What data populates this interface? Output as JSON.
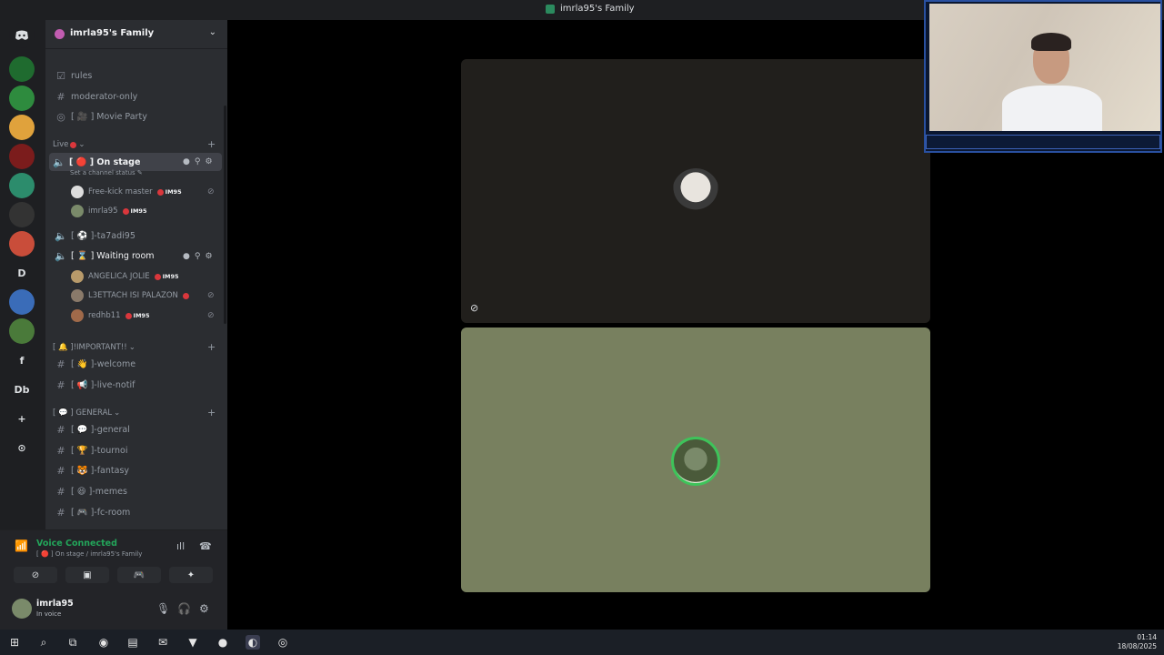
{
  "window": {
    "title": "imrla95's Family"
  },
  "rail": {
    "items": [
      {
        "icon": "discord-home-icon"
      },
      {
        "label": "",
        "color": "#1f6b2f"
      },
      {
        "label": "",
        "color": "#2e8b3e"
      },
      {
        "label": "",
        "color": "#e0a23c"
      },
      {
        "label": "",
        "color": "#7b1c1c"
      },
      {
        "label": "",
        "color": "#2c8c6c"
      },
      {
        "label": "",
        "color": "#222"
      },
      {
        "label": "",
        "color": "#c94d3a"
      },
      {
        "label": "D",
        "color": "#1e1f22"
      },
      {
        "label": "",
        "color": "#3a6cb8"
      },
      {
        "label": "",
        "color": "#4a7a3a"
      },
      {
        "label": "f",
        "color": "#1e1f22"
      },
      {
        "label": "Db",
        "color": "#1e1f22"
      },
      {
        "label": "+",
        "color": "#1e1f22"
      },
      {
        "label": "⊙",
        "color": "#1e1f22"
      }
    ]
  },
  "server": {
    "name": "imrla95's Family"
  },
  "channels": {
    "top": [
      {
        "icon": "☑",
        "label": "rules"
      },
      {
        "icon": "#",
        "label": "moderator-only"
      },
      {
        "icon": "◎",
        "label": "[ 🎥 ] Movie Party"
      }
    ],
    "live_category": "Live",
    "on_stage": {
      "label": "[ 🔴 ] On stage",
      "status": "Set a channel status"
    },
    "on_stage_users": [
      {
        "name": "Free-kick master",
        "badge": "IM95"
      },
      {
        "name": "imrla95",
        "badge": "IM95"
      }
    ],
    "tazadi": {
      "label": "[ ⚽ ]-ta7adi95"
    },
    "waiting": {
      "label": "[ ⌛ ] Waiting room"
    },
    "waiting_users": [
      {
        "name": "ANGELICA JOLIE",
        "badge": "IM95"
      },
      {
        "name": "L3ETTACH ISI PALAZON",
        "badge": ""
      },
      {
        "name": "redhb11",
        "badge": "IM95"
      }
    ],
    "important_category": "[ 🔔 ]!IMPORTANT!!",
    "important": [
      {
        "label": "[ 👋 ]-welcome"
      },
      {
        "label": "[ 📢 ]-live-notif"
      }
    ],
    "general_category": "[ 💬 ] GENERAL",
    "general": [
      {
        "label": "[ 💬 ]-general"
      },
      {
        "label": "[ 🏆 ]-tournoi"
      },
      {
        "label": "[ 🐯 ]-fantasy"
      },
      {
        "label": "[ 😆 ]-memes"
      },
      {
        "label": "[ 🎮 ]-fc-room"
      }
    ]
  },
  "voice": {
    "status": "Voice Connected",
    "location": "[ 🔴 ] On stage / imrla95's Family"
  },
  "user": {
    "name": "imrla95",
    "status": "In voice"
  },
  "clock": {
    "time": "01:14",
    "date": "18/08/2025"
  },
  "colors": {
    "accent_green": "#23a55a",
    "tile_dark": "#211f1c",
    "tile_olive": "#78805f"
  }
}
